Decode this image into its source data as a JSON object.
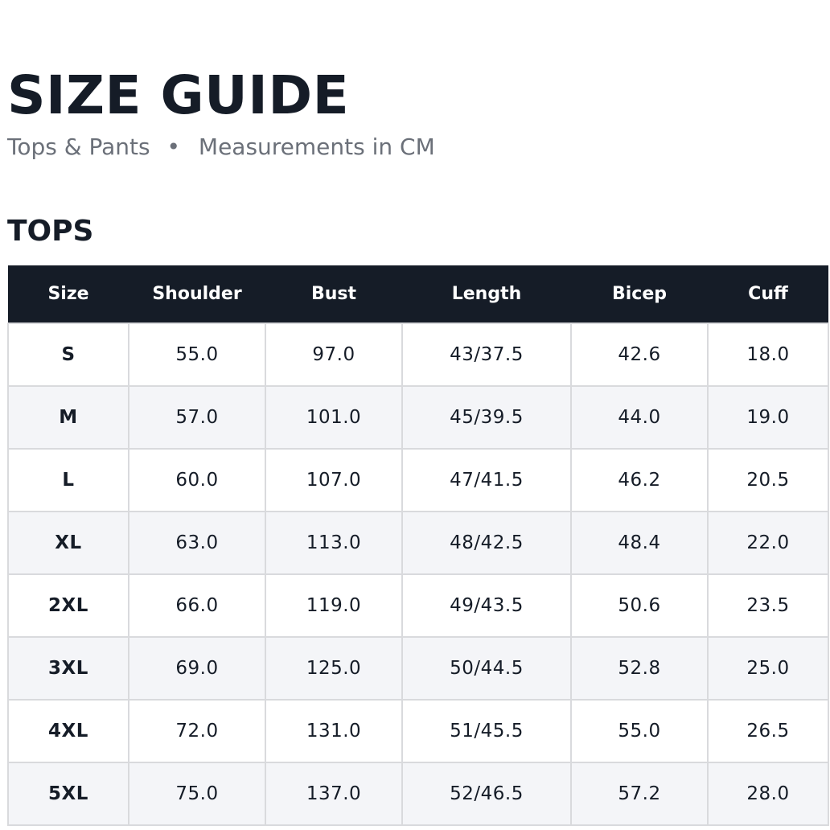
{
  "header": {
    "title": "SIZE GUIDE",
    "subtitle_left": "Tops & Pants",
    "subtitle_separator": "•",
    "subtitle_right": "Measurements in CM"
  },
  "tops": {
    "section_title": "TOPS",
    "columns": [
      "Size",
      "Shoulder",
      "Bust",
      "Length",
      "Bicep",
      "Cuff"
    ],
    "rows": [
      [
        "S",
        "55.0",
        "97.0",
        "43/37.5",
        "42.6",
        "18.0"
      ],
      [
        "M",
        "57.0",
        "101.0",
        "45/39.5",
        "44.0",
        "19.0"
      ],
      [
        "L",
        "60.0",
        "107.0",
        "47/41.5",
        "46.2",
        "20.5"
      ],
      [
        "XL",
        "63.0",
        "113.0",
        "48/42.5",
        "48.4",
        "22.0"
      ],
      [
        "2XL",
        "66.0",
        "119.0",
        "49/43.5",
        "50.6",
        "23.5"
      ],
      [
        "3XL",
        "69.0",
        "125.0",
        "50/44.5",
        "52.8",
        "25.0"
      ],
      [
        "4XL",
        "72.0",
        "131.0",
        "51/45.5",
        "55.0",
        "26.5"
      ],
      [
        "5XL",
        "75.0",
        "137.0",
        "52/46.5",
        "57.2",
        "28.0"
      ]
    ]
  },
  "colors": {
    "header_bg": "#151c27",
    "header_text": "#ffffff",
    "text_primary": "#151c27",
    "text_muted": "#6b7079",
    "row_alt_bg": "#f4f5f8",
    "border": "#d9dadd"
  }
}
